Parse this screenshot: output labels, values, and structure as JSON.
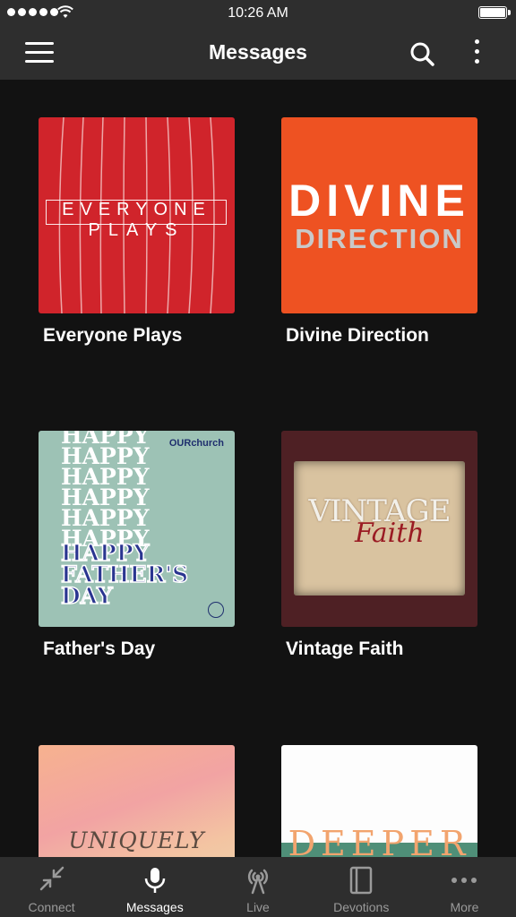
{
  "status_bar": {
    "time": "10:26 AM",
    "battery_level": 1.0
  },
  "nav": {
    "title": "Messages",
    "menu_icon": "hamburger-menu-icon",
    "search_icon": "search-icon",
    "more_icon": "vertical-ellipsis-icon"
  },
  "messages": [
    {
      "title": "Everyone Plays",
      "art_line1": "EVERYONE",
      "art_line2": "PLAYS"
    },
    {
      "title": "Divine Direction",
      "art_line1": "DIVINE",
      "art_line2": "DIRECTION"
    },
    {
      "title": "Father's Day",
      "art_happy": "HAPPY",
      "art_line1": "HAPPY",
      "art_line2": "FATHER'S",
      "art_line3": "DAY",
      "art_logo": "OURchurch"
    },
    {
      "title": "Vintage Faith",
      "art_line1": "VINTAGE",
      "art_line2": "Faith"
    },
    {
      "title": "",
      "art_line1": "UNIQUELY BETTER"
    },
    {
      "title": "",
      "art_line1": "DEEPER"
    }
  ],
  "tabs": [
    {
      "label": "Connect",
      "icon": "collapse-arrows-icon",
      "active": false
    },
    {
      "label": "Messages",
      "icon": "microphone-icon",
      "active": true
    },
    {
      "label": "Live",
      "icon": "broadcast-tower-icon",
      "active": false
    },
    {
      "label": "Devotions",
      "icon": "book-icon",
      "active": false
    },
    {
      "label": "More",
      "icon": "horizontal-ellipsis-icon",
      "active": false
    }
  ],
  "colors": {
    "bar_bg": "#2e2e2e",
    "content_bg": "#121212",
    "active_tab": "#ffffff",
    "inactive_tab": "#9a9a9a"
  }
}
